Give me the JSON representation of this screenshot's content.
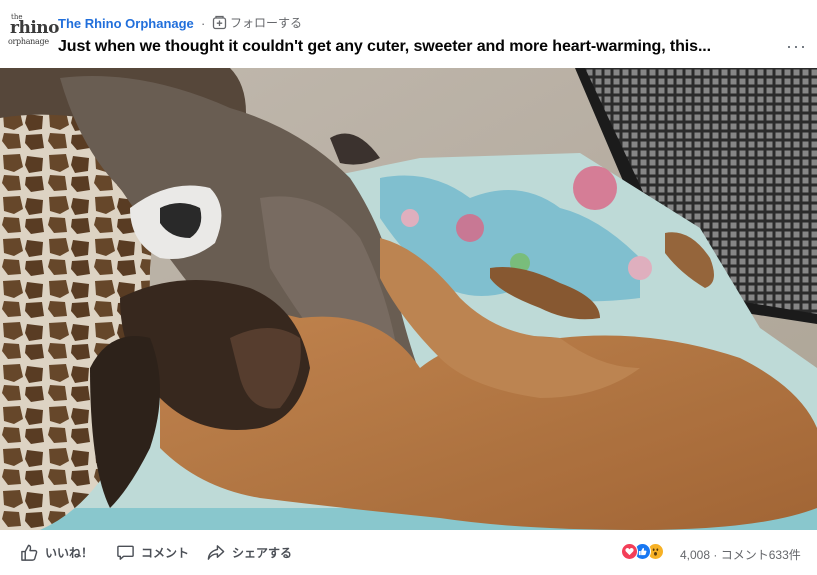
{
  "header": {
    "logo_text": [
      "the",
      "rhino",
      "orphanage"
    ],
    "page_name": "The Rhino Orphanage",
    "separator": "·",
    "follow_label": "フォローする",
    "post_text": "Just when we thought it couldn't get any cuter, sweeter and more heart-warming, this...",
    "more_label": "···"
  },
  "video": {
    "description_icon": "video-frame"
  },
  "footer": {
    "like_label": "いいね！",
    "comment_label": "コメント",
    "share_label": "シェアする",
    "reactions": [
      "love",
      "like",
      "wow"
    ],
    "reaction_count": "4,008",
    "counts_separator": "·",
    "comment_count": "コメント633件"
  },
  "colors": {
    "page_name": "#216fdb",
    "secondary_text": "#65676b",
    "like_blue": "#1877f2",
    "love_red": "#f33e58",
    "wow_yellow": "#f7b125"
  }
}
